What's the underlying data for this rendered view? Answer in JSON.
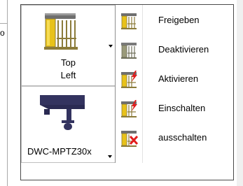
{
  "background_fragments": {
    "left_text": "o"
  },
  "ribbon": {
    "preset_button": {
      "label_line1": "Top",
      "label_line2": "Left",
      "icon": "gate-icon"
    },
    "camera_button": {
      "label": "DWC-MPTZ30x",
      "icon": "ptz-camera-icon"
    }
  },
  "menu": {
    "items": [
      {
        "label": "Freigeben",
        "icon": "gate-release-icon"
      },
      {
        "label": "Deaktivieren",
        "icon": "gate-deactivate-icon"
      },
      {
        "label": "Aktivieren",
        "icon": "gate-activate-icon"
      },
      {
        "label": "Einschalten",
        "icon": "gate-switch-on-icon"
      },
      {
        "label": "ausschalten",
        "icon": "gate-switch-off-icon"
      }
    ]
  },
  "colors": {
    "gate_yellow": "#e8c21a",
    "gate_frame": "#8b7b3a",
    "camera_blue": "#33335f",
    "alarm_red": "#e21d1d"
  }
}
